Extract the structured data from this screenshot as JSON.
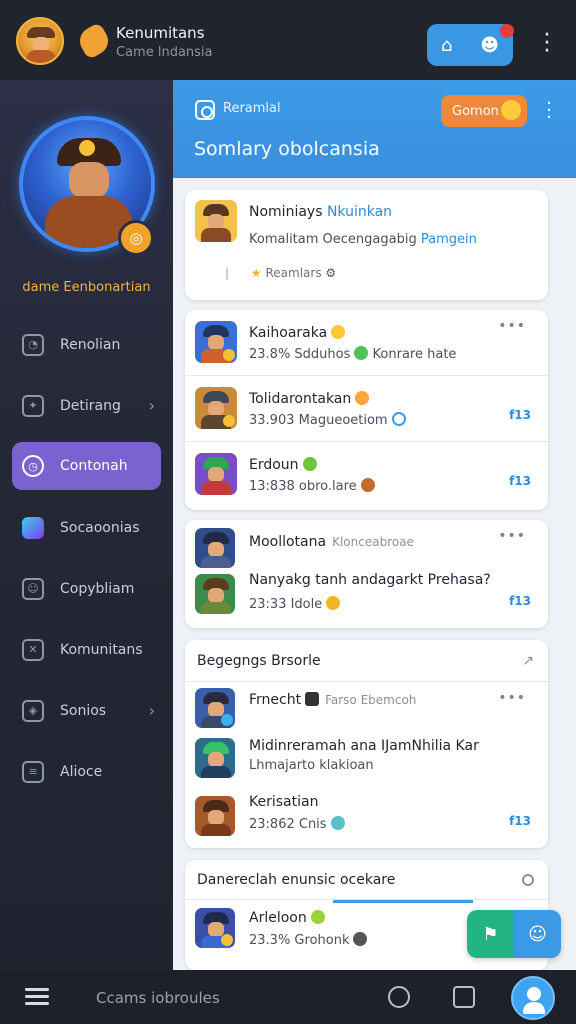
{
  "topbar": {
    "app_title": "Kenumitans",
    "app_subtitle": "Came lndansia"
  },
  "sidebar": {
    "profile_name": "dame Eenbonartian",
    "items": [
      {
        "label": "Renolian",
        "icon": "gauge-icon",
        "chevron": false,
        "active": false
      },
      {
        "label": "Detirang",
        "icon": "bird-icon",
        "chevron": true,
        "active": false
      },
      {
        "label": "Contonah",
        "icon": "clock-icon",
        "chevron": false,
        "active": true
      },
      {
        "label": "Socaoonias",
        "icon": "wrench-icon",
        "chevron": false,
        "active": false
      },
      {
        "label": "Copybliam",
        "icon": "people-icon",
        "chevron": false,
        "active": false
      },
      {
        "label": "Komunitans",
        "icon": "pin-icon",
        "chevron": false,
        "active": false
      },
      {
        "label": "Sonios",
        "icon": "shield-icon",
        "chevron": true,
        "active": false
      },
      {
        "label": "Alioce",
        "icon": "list-icon",
        "chevron": false,
        "active": false
      }
    ]
  },
  "main": {
    "header_small": "Reramlal",
    "header_pill": "Gomon",
    "header_title": "Somlary obolcansia",
    "featured": {
      "title": "Nominiays",
      "title_accent": "Nkuinkan",
      "subtitle": "Komalitam Oecengagabig",
      "subtitle_accent": "Pamgein",
      "meta": "Reamlars"
    },
    "card1_rows": [
      {
        "title": "Kaihoaraka",
        "sub": "23.8% Sdduhos",
        "sub2": "Konrare hate",
        "tag": ""
      },
      {
        "title": "Tolidarontakan",
        "sub": "33.903",
        "sub2": "Magueoetiom",
        "tag": "f13"
      },
      {
        "title": "Erdoun",
        "sub": "13:838 obro.lare",
        "sub2": "",
        "tag": "f13"
      }
    ],
    "card2_rows": [
      {
        "title": "Moollotana",
        "muted": "Klonceabroae",
        "sub": "",
        "tag": ""
      },
      {
        "title": "Nanyakg tanh andagarkt Prehasa?",
        "muted": "",
        "sub": "23:33 Idole",
        "tag": "f13"
      }
    ],
    "section1": {
      "title": "Begegngs Brsorle",
      "rows": [
        {
          "title": "Frnecht",
          "muted": "Farso Ebemcoh",
          "sub": "",
          "tag": ""
        },
        {
          "title": "Midinreramah ana IJamNhilia Kar",
          "muted": "",
          "sub": "Lhmajarto klakioan",
          "tag": ""
        },
        {
          "title": "Kerisatian",
          "muted": "",
          "sub": "23:862 Cnis",
          "tag": "f13"
        }
      ]
    },
    "section2": {
      "title": "Danereclah enunsic ocekare",
      "rows": [
        {
          "title": "Arleloon",
          "muted": "",
          "sub": "23.3% Grohonk",
          "tag": ""
        }
      ]
    }
  },
  "bottombar": {
    "text": "Ccams iobroules"
  }
}
